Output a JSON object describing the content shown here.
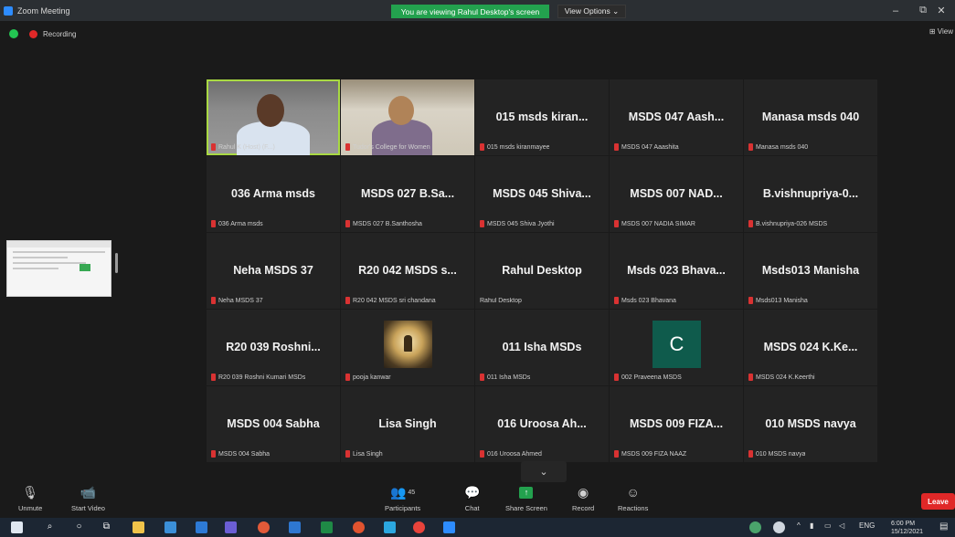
{
  "window": {
    "title": "Zoom Meeting",
    "banner": "You are viewing Rahul Desktop's screen",
    "view_options": "View Options ⌄",
    "minimize": "–",
    "maximize": "⧉",
    "close": "✕"
  },
  "top": {
    "recording": "Recording",
    "view": "⊞ View"
  },
  "tiles": [
    {
      "type": "video",
      "label": "Rahul K (Host) (F...)",
      "speaker": true
    },
    {
      "type": "video",
      "label": "Tudor's College for Women"
    },
    {
      "type": "name",
      "name": "015 msds kiran...",
      "label": "015 msds kiranmayee"
    },
    {
      "type": "name",
      "name": "MSDS 047 Aash...",
      "label": "MSDS 047 Aaashita"
    },
    {
      "type": "name",
      "name": "Manasa msds 040",
      "label": "Manasa msds 040"
    },
    {
      "type": "name",
      "name": "036 Arma msds",
      "label": "036 Arma msds"
    },
    {
      "type": "name",
      "name": "MSDS 027 B.Sa...",
      "label": "MSDS 027 B.Santhosha"
    },
    {
      "type": "name",
      "name": "MSDS 045 Shiva...",
      "label": "MSDS 045 Shiva Jyothi"
    },
    {
      "type": "name",
      "name": "MSDS 007 NAD...",
      "label": "MSDS 007 NADIA SIMAR"
    },
    {
      "type": "name",
      "name": "B.vishnupriya-0...",
      "label": "B.vishnupriya-026 MSDS"
    },
    {
      "type": "name",
      "name": "Neha MSDS 37",
      "label": "Neha MSDS 37"
    },
    {
      "type": "name",
      "name": "R20 042 MSDS s...",
      "label": "R20 042 MSDS sri chandana"
    },
    {
      "type": "name",
      "name": "Rahul Desktop",
      "label": "Rahul Desktop",
      "nomic": true
    },
    {
      "type": "name",
      "name": "Msds 023 Bhava...",
      "label": "Msds 023 Bhavana"
    },
    {
      "type": "name",
      "name": "Msds013 Manisha",
      "label": "Msds013 Manisha"
    },
    {
      "type": "name",
      "name": "R20 039 Roshni...",
      "label": "R20 039 Roshni Kumari MSDs"
    },
    {
      "type": "photo",
      "label": "pooja kanwar"
    },
    {
      "type": "name",
      "name": "011 Isha MSDs",
      "label": "011 Isha MSDs"
    },
    {
      "type": "letter",
      "letter": "C",
      "label": "002 Praveena MSDS"
    },
    {
      "type": "name",
      "name": "MSDS 024 K.Ke...",
      "label": "MSDS 024 K.Keerthi"
    },
    {
      "type": "name",
      "name": "MSDS 004 Sabha",
      "label": "MSDS 004 Sabha"
    },
    {
      "type": "name",
      "name": "Lisa Singh",
      "label": "Lisa Singh"
    },
    {
      "type": "name",
      "name": "016 Uroosa Ah...",
      "label": "016 Uroosa Ahmed"
    },
    {
      "type": "name",
      "name": "MSDS 009 FIZA...",
      "label": "MSDS 009 FIZA NAAZ"
    },
    {
      "type": "name",
      "name": "010 MSDS navya",
      "label": "010 MSDS navya"
    }
  ],
  "toolbar": {
    "unmute": "Unmute",
    "start_video": "Start Video",
    "participants": "Participants",
    "participants_count": "45",
    "chat": "Chat",
    "share_screen": "Share Screen",
    "record": "Record",
    "reactions": "Reactions",
    "leave": "Leave",
    "chevron": "⌄"
  },
  "taskbar": {
    "lang": "ENG",
    "time": "6:00 PM",
    "date": "15/12/2021"
  },
  "colors": {
    "speaker_border": "#a9d943",
    "share_green": "#23a14e",
    "leave_red": "#e02828",
    "avatar_c": "#0f5b4c"
  }
}
